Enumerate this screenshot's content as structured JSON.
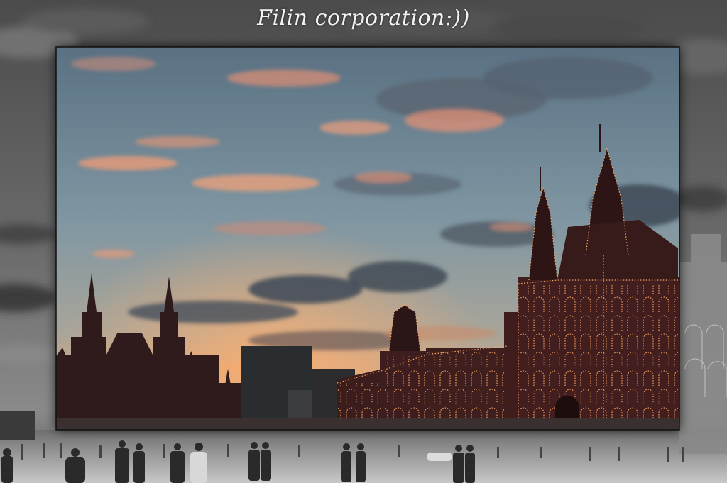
{
  "watermark": {
    "text": "Filin corporation:))"
  },
  "palette": {
    "sky_top": "#5f7688",
    "sky_mid": "#7e95a0",
    "sky_horizon": "#d9a680",
    "cloud_pink": "#e89a78",
    "cloud_dark": "#3e4a55",
    "building_red": "#4a2020",
    "lights": "#ffb070",
    "frame_gray": "#3a3a3a"
  },
  "scene": {
    "subject": "Red Square at dusk, State Historical Museum left, GUM department store right with illuminated outline",
    "style": "color photo framed by a blurred grayscale copy of itself"
  }
}
